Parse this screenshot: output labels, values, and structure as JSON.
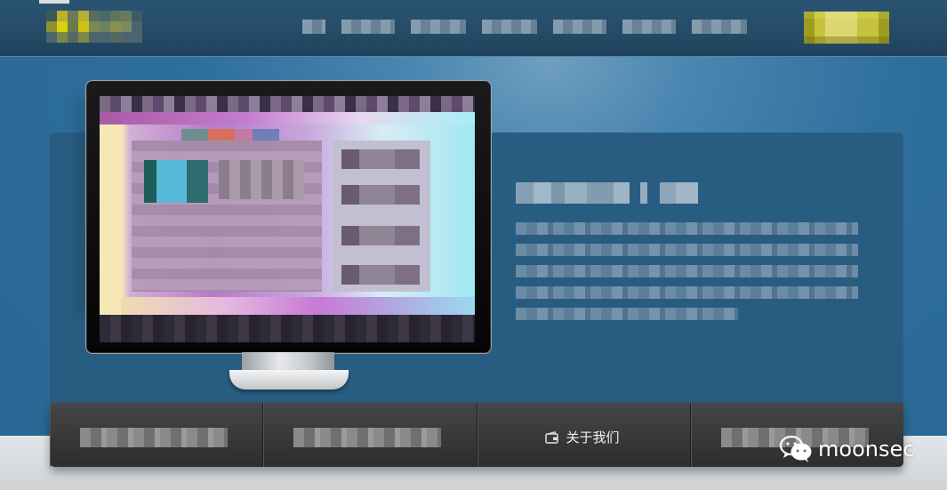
{
  "header": {
    "logo_text": "",
    "nav": [
      "",
      "",
      "",
      "",
      "",
      "",
      ""
    ],
    "cta_label": ""
  },
  "hero": {
    "title": "",
    "description_lines": [
      "",
      "",
      "",
      "",
      ""
    ]
  },
  "bottom_bar": {
    "items": [
      {
        "label": "",
        "icon": "blurred"
      },
      {
        "label": "",
        "icon": "blurred"
      },
      {
        "label": "关于我们",
        "icon": "wallet-icon"
      },
      {
        "label": "",
        "icon": "blurred"
      }
    ]
  },
  "watermark": {
    "text": "moonsec",
    "icon": "wechat-icon"
  },
  "colors": {
    "header_bg": "#244a66",
    "panel_bg": "#285c80",
    "cta_yellow": "#c6c33a",
    "bottom_bar": "#3a3a3a"
  }
}
